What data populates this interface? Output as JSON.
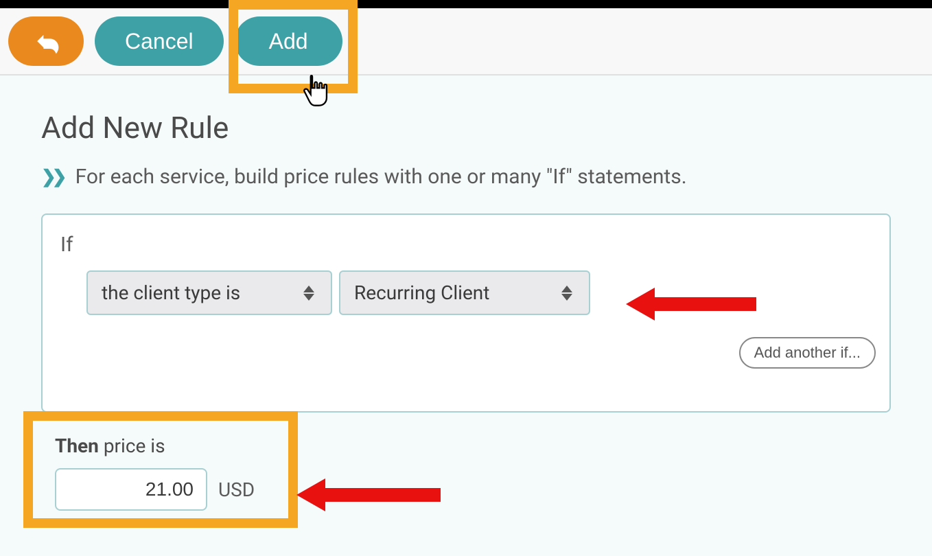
{
  "header": {
    "cancel_label": "Cancel",
    "add_label": "Add"
  },
  "page": {
    "title": "Add New Rule",
    "subtitle": "For each service, build price rules with one or many \"If\" statements."
  },
  "rule": {
    "if_label": "If",
    "condition_type": "the client type is",
    "condition_value": "Recurring Client",
    "add_another_label": "Add another if...",
    "then_prefix": "Then",
    "then_suffix": "price is",
    "price_value": "21.00",
    "currency": "USD"
  }
}
